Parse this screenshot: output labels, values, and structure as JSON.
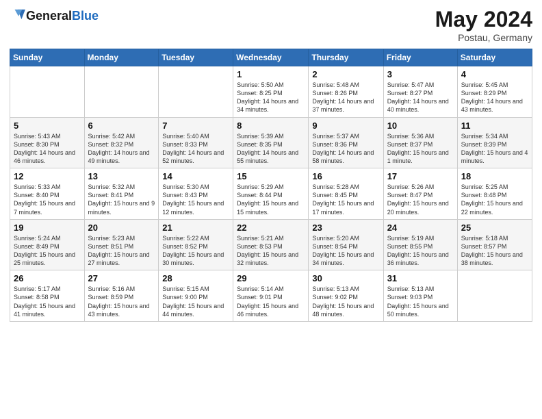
{
  "header": {
    "logo_line1": "General",
    "logo_line2": "Blue",
    "month": "May 2024",
    "location": "Postau, Germany"
  },
  "weekdays": [
    "Sunday",
    "Monday",
    "Tuesday",
    "Wednesday",
    "Thursday",
    "Friday",
    "Saturday"
  ],
  "weeks": [
    [
      {
        "day": "",
        "info": ""
      },
      {
        "day": "",
        "info": ""
      },
      {
        "day": "",
        "info": ""
      },
      {
        "day": "1",
        "info": "Sunrise: 5:50 AM\nSunset: 8:25 PM\nDaylight: 14 hours and 34 minutes."
      },
      {
        "day": "2",
        "info": "Sunrise: 5:48 AM\nSunset: 8:26 PM\nDaylight: 14 hours and 37 minutes."
      },
      {
        "day": "3",
        "info": "Sunrise: 5:47 AM\nSunset: 8:27 PM\nDaylight: 14 hours and 40 minutes."
      },
      {
        "day": "4",
        "info": "Sunrise: 5:45 AM\nSunset: 8:29 PM\nDaylight: 14 hours and 43 minutes."
      }
    ],
    [
      {
        "day": "5",
        "info": "Sunrise: 5:43 AM\nSunset: 8:30 PM\nDaylight: 14 hours and 46 minutes."
      },
      {
        "day": "6",
        "info": "Sunrise: 5:42 AM\nSunset: 8:32 PM\nDaylight: 14 hours and 49 minutes."
      },
      {
        "day": "7",
        "info": "Sunrise: 5:40 AM\nSunset: 8:33 PM\nDaylight: 14 hours and 52 minutes."
      },
      {
        "day": "8",
        "info": "Sunrise: 5:39 AM\nSunset: 8:35 PM\nDaylight: 14 hours and 55 minutes."
      },
      {
        "day": "9",
        "info": "Sunrise: 5:37 AM\nSunset: 8:36 PM\nDaylight: 14 hours and 58 minutes."
      },
      {
        "day": "10",
        "info": "Sunrise: 5:36 AM\nSunset: 8:37 PM\nDaylight: 15 hours and 1 minute."
      },
      {
        "day": "11",
        "info": "Sunrise: 5:34 AM\nSunset: 8:39 PM\nDaylight: 15 hours and 4 minutes."
      }
    ],
    [
      {
        "day": "12",
        "info": "Sunrise: 5:33 AM\nSunset: 8:40 PM\nDaylight: 15 hours and 7 minutes."
      },
      {
        "day": "13",
        "info": "Sunrise: 5:32 AM\nSunset: 8:41 PM\nDaylight: 15 hours and 9 minutes."
      },
      {
        "day": "14",
        "info": "Sunrise: 5:30 AM\nSunset: 8:43 PM\nDaylight: 15 hours and 12 minutes."
      },
      {
        "day": "15",
        "info": "Sunrise: 5:29 AM\nSunset: 8:44 PM\nDaylight: 15 hours and 15 minutes."
      },
      {
        "day": "16",
        "info": "Sunrise: 5:28 AM\nSunset: 8:45 PM\nDaylight: 15 hours and 17 minutes."
      },
      {
        "day": "17",
        "info": "Sunrise: 5:26 AM\nSunset: 8:47 PM\nDaylight: 15 hours and 20 minutes."
      },
      {
        "day": "18",
        "info": "Sunrise: 5:25 AM\nSunset: 8:48 PM\nDaylight: 15 hours and 22 minutes."
      }
    ],
    [
      {
        "day": "19",
        "info": "Sunrise: 5:24 AM\nSunset: 8:49 PM\nDaylight: 15 hours and 25 minutes."
      },
      {
        "day": "20",
        "info": "Sunrise: 5:23 AM\nSunset: 8:51 PM\nDaylight: 15 hours and 27 minutes."
      },
      {
        "day": "21",
        "info": "Sunrise: 5:22 AM\nSunset: 8:52 PM\nDaylight: 15 hours and 30 minutes."
      },
      {
        "day": "22",
        "info": "Sunrise: 5:21 AM\nSunset: 8:53 PM\nDaylight: 15 hours and 32 minutes."
      },
      {
        "day": "23",
        "info": "Sunrise: 5:20 AM\nSunset: 8:54 PM\nDaylight: 15 hours and 34 minutes."
      },
      {
        "day": "24",
        "info": "Sunrise: 5:19 AM\nSunset: 8:55 PM\nDaylight: 15 hours and 36 minutes."
      },
      {
        "day": "25",
        "info": "Sunrise: 5:18 AM\nSunset: 8:57 PM\nDaylight: 15 hours and 38 minutes."
      }
    ],
    [
      {
        "day": "26",
        "info": "Sunrise: 5:17 AM\nSunset: 8:58 PM\nDaylight: 15 hours and 41 minutes."
      },
      {
        "day": "27",
        "info": "Sunrise: 5:16 AM\nSunset: 8:59 PM\nDaylight: 15 hours and 43 minutes."
      },
      {
        "day": "28",
        "info": "Sunrise: 5:15 AM\nSunset: 9:00 PM\nDaylight: 15 hours and 44 minutes."
      },
      {
        "day": "29",
        "info": "Sunrise: 5:14 AM\nSunset: 9:01 PM\nDaylight: 15 hours and 46 minutes."
      },
      {
        "day": "30",
        "info": "Sunrise: 5:13 AM\nSunset: 9:02 PM\nDaylight: 15 hours and 48 minutes."
      },
      {
        "day": "31",
        "info": "Sunrise: 5:13 AM\nSunset: 9:03 PM\nDaylight: 15 hours and 50 minutes."
      },
      {
        "day": "",
        "info": ""
      }
    ]
  ]
}
